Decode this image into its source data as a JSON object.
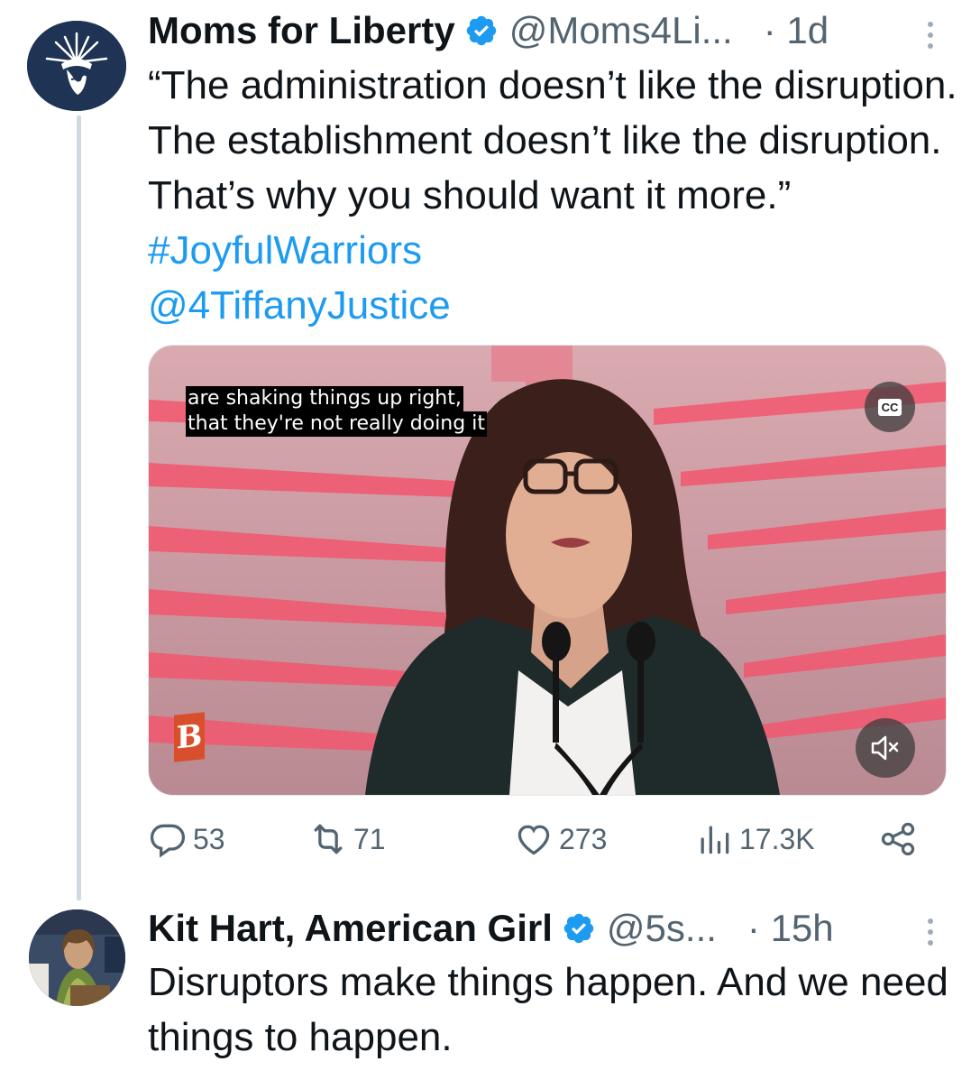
{
  "tweets": [
    {
      "name": "Moms for Liberty",
      "handle": "@Moms4Li...",
      "time": "· 1d",
      "text_plain": "“The administration doesn’t like the disruption. The establishment doesn’t like the disruption. That’s why you should want it more.” ",
      "hashtag": "#JoyfulWarriors",
      "mention": "@4TiffanyJustice",
      "media": {
        "caption_line1": "are shaking things up right,",
        "caption_line2": "that they're not really doing it",
        "cc_label": "CC",
        "watermark": "B"
      },
      "actions": {
        "replies": "53",
        "reposts": "71",
        "likes": "273",
        "views": "17.3K"
      }
    },
    {
      "name": "Kit Hart, American Girl",
      "handle": "@5s...",
      "time": "· 15h",
      "text": "Disruptors make things happen. And we need things to happen."
    }
  ],
  "colors": {
    "link": "#1d9bf0",
    "secondary_text": "#536471",
    "verified": "#1d9bf0",
    "thread_line": "#cfd9de"
  },
  "icons": [
    "statue-of-liberty-logo",
    "verified-badge-icon",
    "more-icon",
    "cc-icon",
    "mute-icon",
    "reply-icon",
    "repost-icon",
    "like-icon",
    "views-icon",
    "share-icon"
  ]
}
